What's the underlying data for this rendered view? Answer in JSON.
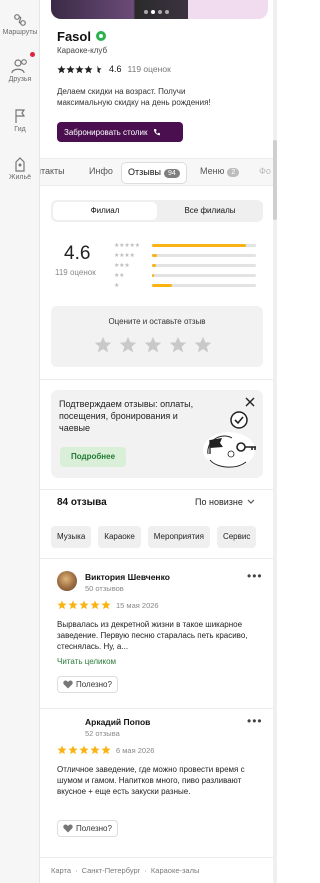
{
  "nav": {
    "items": [
      {
        "label": "Маршруты",
        "icon": "route-icon"
      },
      {
        "label": "Друзья",
        "icon": "friends-icon"
      },
      {
        "label": "Гид",
        "icon": "guide-flag-icon"
      },
      {
        "label": "Жильё",
        "icon": "housing-icon"
      }
    ]
  },
  "place": {
    "name": "Fasol",
    "category": "Караоке-клуб",
    "rating": "4.6",
    "rating_count": "119 оценок",
    "promo": "Делаем скидки на возраст. Получи максимальную скидку на день рождения!",
    "book_label": "Забронировать столик"
  },
  "tabs": [
    {
      "label": "нтакты"
    },
    {
      "label": "Инфо"
    },
    {
      "label": "Отзывы",
      "badge": "94"
    },
    {
      "label": "Меню",
      "badge": "2"
    },
    {
      "label": "Фо"
    }
  ],
  "segment": {
    "branch": "Филиал",
    "all": "Все филиалы"
  },
  "summary": {
    "rating": "4.6",
    "count": "119 оценок",
    "distribution": [
      {
        "stars": 5,
        "fraction": 0.9
      },
      {
        "stars": 4,
        "fraction": 0.05
      },
      {
        "stars": 3,
        "fraction": 0.04
      },
      {
        "stars": 2,
        "fraction": 0.02
      },
      {
        "stars": 1,
        "fraction": 0.19
      }
    ]
  },
  "rate_prompt": "Оцените и оставьте отзыв",
  "confirm": {
    "text": "Подтверждаем отзывы: оплаты, посещения, бронирования и чаевые",
    "button": "Подробнее"
  },
  "reviews_header": {
    "count": "84 отзыва",
    "sort": "По новизне"
  },
  "chips": [
    "Музыка",
    "Караоке",
    "Мероприятия",
    "Сервис"
  ],
  "reviews": [
    {
      "name": "Виктория Шевченко",
      "count": "50 отзывов",
      "date": "15 мая 2026",
      "text": "Вырвалась из декретной жизни в такое шикарное заведение. Первую песню старалась петь красиво, стеснялась. Ну, а...",
      "read_more": "Читать целиком",
      "useful": "Полезно?"
    },
    {
      "name": "Аркадий Попов",
      "count": "52 отзыва",
      "date": "6 мая 2026",
      "text": "Отличное заведение, где можно провести время с шумом и гамом. Напитков много, пиво разливают вкусное + еще есть закуски разные.",
      "useful": "Полезно?"
    }
  ],
  "footer": {
    "items": [
      "Карта",
      "·",
      "Санкт-Петербург",
      "·",
      "Караоке-залы"
    ]
  },
  "colors": {
    "brand": "#4a0f4f",
    "star": "#fbb313",
    "green": "#2bb24c",
    "link": "#2b7a3b"
  }
}
